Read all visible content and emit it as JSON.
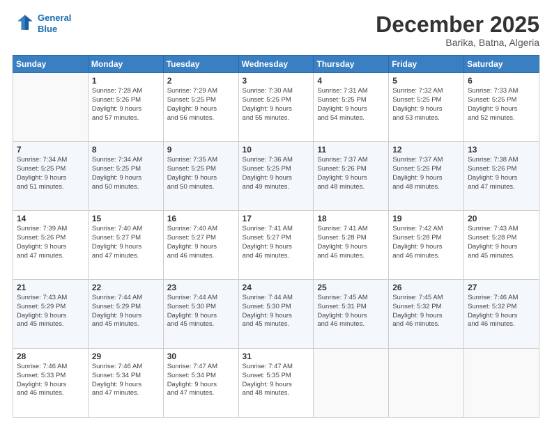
{
  "header": {
    "logo_line1": "General",
    "logo_line2": "Blue",
    "month": "December 2025",
    "location": "Barika, Batna, Algeria"
  },
  "days_of_week": [
    "Sunday",
    "Monday",
    "Tuesday",
    "Wednesday",
    "Thursday",
    "Friday",
    "Saturday"
  ],
  "weeks": [
    [
      {
        "day": "",
        "text": ""
      },
      {
        "day": "1",
        "text": "Sunrise: 7:28 AM\nSunset: 5:26 PM\nDaylight: 9 hours\nand 57 minutes."
      },
      {
        "day": "2",
        "text": "Sunrise: 7:29 AM\nSunset: 5:25 PM\nDaylight: 9 hours\nand 56 minutes."
      },
      {
        "day": "3",
        "text": "Sunrise: 7:30 AM\nSunset: 5:25 PM\nDaylight: 9 hours\nand 55 minutes."
      },
      {
        "day": "4",
        "text": "Sunrise: 7:31 AM\nSunset: 5:25 PM\nDaylight: 9 hours\nand 54 minutes."
      },
      {
        "day": "5",
        "text": "Sunrise: 7:32 AM\nSunset: 5:25 PM\nDaylight: 9 hours\nand 53 minutes."
      },
      {
        "day": "6",
        "text": "Sunrise: 7:33 AM\nSunset: 5:25 PM\nDaylight: 9 hours\nand 52 minutes."
      }
    ],
    [
      {
        "day": "7",
        "text": "Sunrise: 7:34 AM\nSunset: 5:25 PM\nDaylight: 9 hours\nand 51 minutes."
      },
      {
        "day": "8",
        "text": "Sunrise: 7:34 AM\nSunset: 5:25 PM\nDaylight: 9 hours\nand 50 minutes."
      },
      {
        "day": "9",
        "text": "Sunrise: 7:35 AM\nSunset: 5:25 PM\nDaylight: 9 hours\nand 50 minutes."
      },
      {
        "day": "10",
        "text": "Sunrise: 7:36 AM\nSunset: 5:25 PM\nDaylight: 9 hours\nand 49 minutes."
      },
      {
        "day": "11",
        "text": "Sunrise: 7:37 AM\nSunset: 5:26 PM\nDaylight: 9 hours\nand 48 minutes."
      },
      {
        "day": "12",
        "text": "Sunrise: 7:37 AM\nSunset: 5:26 PM\nDaylight: 9 hours\nand 48 minutes."
      },
      {
        "day": "13",
        "text": "Sunrise: 7:38 AM\nSunset: 5:26 PM\nDaylight: 9 hours\nand 47 minutes."
      }
    ],
    [
      {
        "day": "14",
        "text": "Sunrise: 7:39 AM\nSunset: 5:26 PM\nDaylight: 9 hours\nand 47 minutes."
      },
      {
        "day": "15",
        "text": "Sunrise: 7:40 AM\nSunset: 5:27 PM\nDaylight: 9 hours\nand 47 minutes."
      },
      {
        "day": "16",
        "text": "Sunrise: 7:40 AM\nSunset: 5:27 PM\nDaylight: 9 hours\nand 46 minutes."
      },
      {
        "day": "17",
        "text": "Sunrise: 7:41 AM\nSunset: 5:27 PM\nDaylight: 9 hours\nand 46 minutes."
      },
      {
        "day": "18",
        "text": "Sunrise: 7:41 AM\nSunset: 5:28 PM\nDaylight: 9 hours\nand 46 minutes."
      },
      {
        "day": "19",
        "text": "Sunrise: 7:42 AM\nSunset: 5:28 PM\nDaylight: 9 hours\nand 46 minutes."
      },
      {
        "day": "20",
        "text": "Sunrise: 7:43 AM\nSunset: 5:28 PM\nDaylight: 9 hours\nand 45 minutes."
      }
    ],
    [
      {
        "day": "21",
        "text": "Sunrise: 7:43 AM\nSunset: 5:29 PM\nDaylight: 9 hours\nand 45 minutes."
      },
      {
        "day": "22",
        "text": "Sunrise: 7:44 AM\nSunset: 5:29 PM\nDaylight: 9 hours\nand 45 minutes."
      },
      {
        "day": "23",
        "text": "Sunrise: 7:44 AM\nSunset: 5:30 PM\nDaylight: 9 hours\nand 45 minutes."
      },
      {
        "day": "24",
        "text": "Sunrise: 7:44 AM\nSunset: 5:30 PM\nDaylight: 9 hours\nand 45 minutes."
      },
      {
        "day": "25",
        "text": "Sunrise: 7:45 AM\nSunset: 5:31 PM\nDaylight: 9 hours\nand 46 minutes."
      },
      {
        "day": "26",
        "text": "Sunrise: 7:45 AM\nSunset: 5:32 PM\nDaylight: 9 hours\nand 46 minutes."
      },
      {
        "day": "27",
        "text": "Sunrise: 7:46 AM\nSunset: 5:32 PM\nDaylight: 9 hours\nand 46 minutes."
      }
    ],
    [
      {
        "day": "28",
        "text": "Sunrise: 7:46 AM\nSunset: 5:33 PM\nDaylight: 9 hours\nand 46 minutes."
      },
      {
        "day": "29",
        "text": "Sunrise: 7:46 AM\nSunset: 5:34 PM\nDaylight: 9 hours\nand 47 minutes."
      },
      {
        "day": "30",
        "text": "Sunrise: 7:47 AM\nSunset: 5:34 PM\nDaylight: 9 hours\nand 47 minutes."
      },
      {
        "day": "31",
        "text": "Sunrise: 7:47 AM\nSunset: 5:35 PM\nDaylight: 9 hours\nand 48 minutes."
      },
      {
        "day": "",
        "text": ""
      },
      {
        "day": "",
        "text": ""
      },
      {
        "day": "",
        "text": ""
      }
    ]
  ]
}
